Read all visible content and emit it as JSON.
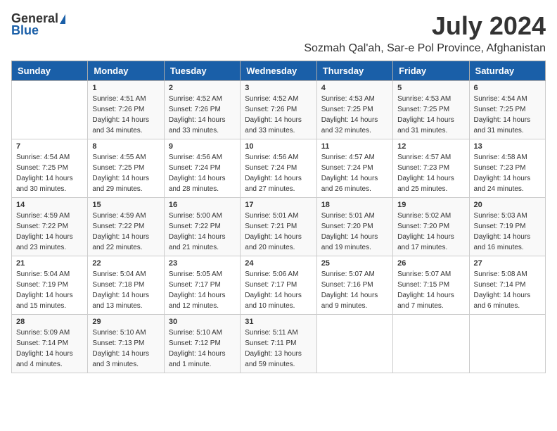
{
  "logo": {
    "general": "General",
    "blue": "Blue"
  },
  "title": "July 2024",
  "subtitle": "Sozmah Qal'ah, Sar-e Pol Province, Afghanistan",
  "days": [
    "Sunday",
    "Monday",
    "Tuesday",
    "Wednesday",
    "Thursday",
    "Friday",
    "Saturday"
  ],
  "weeks": [
    [
      {
        "num": "",
        "sunrise": "",
        "sunset": "",
        "daylight": ""
      },
      {
        "num": "1",
        "sunrise": "Sunrise: 4:51 AM",
        "sunset": "Sunset: 7:26 PM",
        "daylight": "Daylight: 14 hours and 34 minutes."
      },
      {
        "num": "2",
        "sunrise": "Sunrise: 4:52 AM",
        "sunset": "Sunset: 7:26 PM",
        "daylight": "Daylight: 14 hours and 33 minutes."
      },
      {
        "num": "3",
        "sunrise": "Sunrise: 4:52 AM",
        "sunset": "Sunset: 7:26 PM",
        "daylight": "Daylight: 14 hours and 33 minutes."
      },
      {
        "num": "4",
        "sunrise": "Sunrise: 4:53 AM",
        "sunset": "Sunset: 7:25 PM",
        "daylight": "Daylight: 14 hours and 32 minutes."
      },
      {
        "num": "5",
        "sunrise": "Sunrise: 4:53 AM",
        "sunset": "Sunset: 7:25 PM",
        "daylight": "Daylight: 14 hours and 31 minutes."
      },
      {
        "num": "6",
        "sunrise": "Sunrise: 4:54 AM",
        "sunset": "Sunset: 7:25 PM",
        "daylight": "Daylight: 14 hours and 31 minutes."
      }
    ],
    [
      {
        "num": "7",
        "sunrise": "Sunrise: 4:54 AM",
        "sunset": "Sunset: 7:25 PM",
        "daylight": "Daylight: 14 hours and 30 minutes."
      },
      {
        "num": "8",
        "sunrise": "Sunrise: 4:55 AM",
        "sunset": "Sunset: 7:25 PM",
        "daylight": "Daylight: 14 hours and 29 minutes."
      },
      {
        "num": "9",
        "sunrise": "Sunrise: 4:56 AM",
        "sunset": "Sunset: 7:24 PM",
        "daylight": "Daylight: 14 hours and 28 minutes."
      },
      {
        "num": "10",
        "sunrise": "Sunrise: 4:56 AM",
        "sunset": "Sunset: 7:24 PM",
        "daylight": "Daylight: 14 hours and 27 minutes."
      },
      {
        "num": "11",
        "sunrise": "Sunrise: 4:57 AM",
        "sunset": "Sunset: 7:24 PM",
        "daylight": "Daylight: 14 hours and 26 minutes."
      },
      {
        "num": "12",
        "sunrise": "Sunrise: 4:57 AM",
        "sunset": "Sunset: 7:23 PM",
        "daylight": "Daylight: 14 hours and 25 minutes."
      },
      {
        "num": "13",
        "sunrise": "Sunrise: 4:58 AM",
        "sunset": "Sunset: 7:23 PM",
        "daylight": "Daylight: 14 hours and 24 minutes."
      }
    ],
    [
      {
        "num": "14",
        "sunrise": "Sunrise: 4:59 AM",
        "sunset": "Sunset: 7:22 PM",
        "daylight": "Daylight: 14 hours and 23 minutes."
      },
      {
        "num": "15",
        "sunrise": "Sunrise: 4:59 AM",
        "sunset": "Sunset: 7:22 PM",
        "daylight": "Daylight: 14 hours and 22 minutes."
      },
      {
        "num": "16",
        "sunrise": "Sunrise: 5:00 AM",
        "sunset": "Sunset: 7:22 PM",
        "daylight": "Daylight: 14 hours and 21 minutes."
      },
      {
        "num": "17",
        "sunrise": "Sunrise: 5:01 AM",
        "sunset": "Sunset: 7:21 PM",
        "daylight": "Daylight: 14 hours and 20 minutes."
      },
      {
        "num": "18",
        "sunrise": "Sunrise: 5:01 AM",
        "sunset": "Sunset: 7:20 PM",
        "daylight": "Daylight: 14 hours and 19 minutes."
      },
      {
        "num": "19",
        "sunrise": "Sunrise: 5:02 AM",
        "sunset": "Sunset: 7:20 PM",
        "daylight": "Daylight: 14 hours and 17 minutes."
      },
      {
        "num": "20",
        "sunrise": "Sunrise: 5:03 AM",
        "sunset": "Sunset: 7:19 PM",
        "daylight": "Daylight: 14 hours and 16 minutes."
      }
    ],
    [
      {
        "num": "21",
        "sunrise": "Sunrise: 5:04 AM",
        "sunset": "Sunset: 7:19 PM",
        "daylight": "Daylight: 14 hours and 15 minutes."
      },
      {
        "num": "22",
        "sunrise": "Sunrise: 5:04 AM",
        "sunset": "Sunset: 7:18 PM",
        "daylight": "Daylight: 14 hours and 13 minutes."
      },
      {
        "num": "23",
        "sunrise": "Sunrise: 5:05 AM",
        "sunset": "Sunset: 7:17 PM",
        "daylight": "Daylight: 14 hours and 12 minutes."
      },
      {
        "num": "24",
        "sunrise": "Sunrise: 5:06 AM",
        "sunset": "Sunset: 7:17 PM",
        "daylight": "Daylight: 14 hours and 10 minutes."
      },
      {
        "num": "25",
        "sunrise": "Sunrise: 5:07 AM",
        "sunset": "Sunset: 7:16 PM",
        "daylight": "Daylight: 14 hours and 9 minutes."
      },
      {
        "num": "26",
        "sunrise": "Sunrise: 5:07 AM",
        "sunset": "Sunset: 7:15 PM",
        "daylight": "Daylight: 14 hours and 7 minutes."
      },
      {
        "num": "27",
        "sunrise": "Sunrise: 5:08 AM",
        "sunset": "Sunset: 7:14 PM",
        "daylight": "Daylight: 14 hours and 6 minutes."
      }
    ],
    [
      {
        "num": "28",
        "sunrise": "Sunrise: 5:09 AM",
        "sunset": "Sunset: 7:14 PM",
        "daylight": "Daylight: 14 hours and 4 minutes."
      },
      {
        "num": "29",
        "sunrise": "Sunrise: 5:10 AM",
        "sunset": "Sunset: 7:13 PM",
        "daylight": "Daylight: 14 hours and 3 minutes."
      },
      {
        "num": "30",
        "sunrise": "Sunrise: 5:10 AM",
        "sunset": "Sunset: 7:12 PM",
        "daylight": "Daylight: 14 hours and 1 minute."
      },
      {
        "num": "31",
        "sunrise": "Sunrise: 5:11 AM",
        "sunset": "Sunset: 7:11 PM",
        "daylight": "Daylight: 13 hours and 59 minutes."
      },
      {
        "num": "",
        "sunrise": "",
        "sunset": "",
        "daylight": ""
      },
      {
        "num": "",
        "sunrise": "",
        "sunset": "",
        "daylight": ""
      },
      {
        "num": "",
        "sunrise": "",
        "sunset": "",
        "daylight": ""
      }
    ]
  ]
}
